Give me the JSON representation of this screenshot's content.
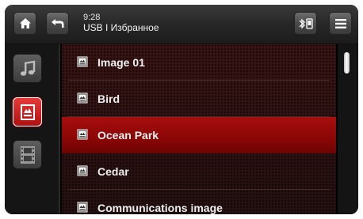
{
  "status": {
    "time": "9:28",
    "source": "USB I Избранное"
  },
  "topbar": {
    "home_icon": "home-icon",
    "back_icon": "back-arrow-icon",
    "bluetooth_icon": "bluetooth-phone-icon",
    "menu_icon": "hamburger-menu-icon"
  },
  "sidebar": {
    "items": [
      {
        "icon": "music-icon",
        "active": false
      },
      {
        "icon": "picture-icon",
        "active": true
      },
      {
        "icon": "film-icon",
        "active": false
      }
    ]
  },
  "list": {
    "items": [
      {
        "label": "Image 01",
        "selected": false
      },
      {
        "label": "Bird",
        "selected": false
      },
      {
        "label": "Ocean Park",
        "selected": true
      },
      {
        "label": "Cedar",
        "selected": false
      },
      {
        "label": "Communications image",
        "selected": false
      }
    ]
  },
  "scrollbar": {
    "position": 0.0
  },
  "colors": {
    "accent": "#b01010",
    "selected_row": "#a80e0e",
    "text": "#f0f0f0"
  }
}
